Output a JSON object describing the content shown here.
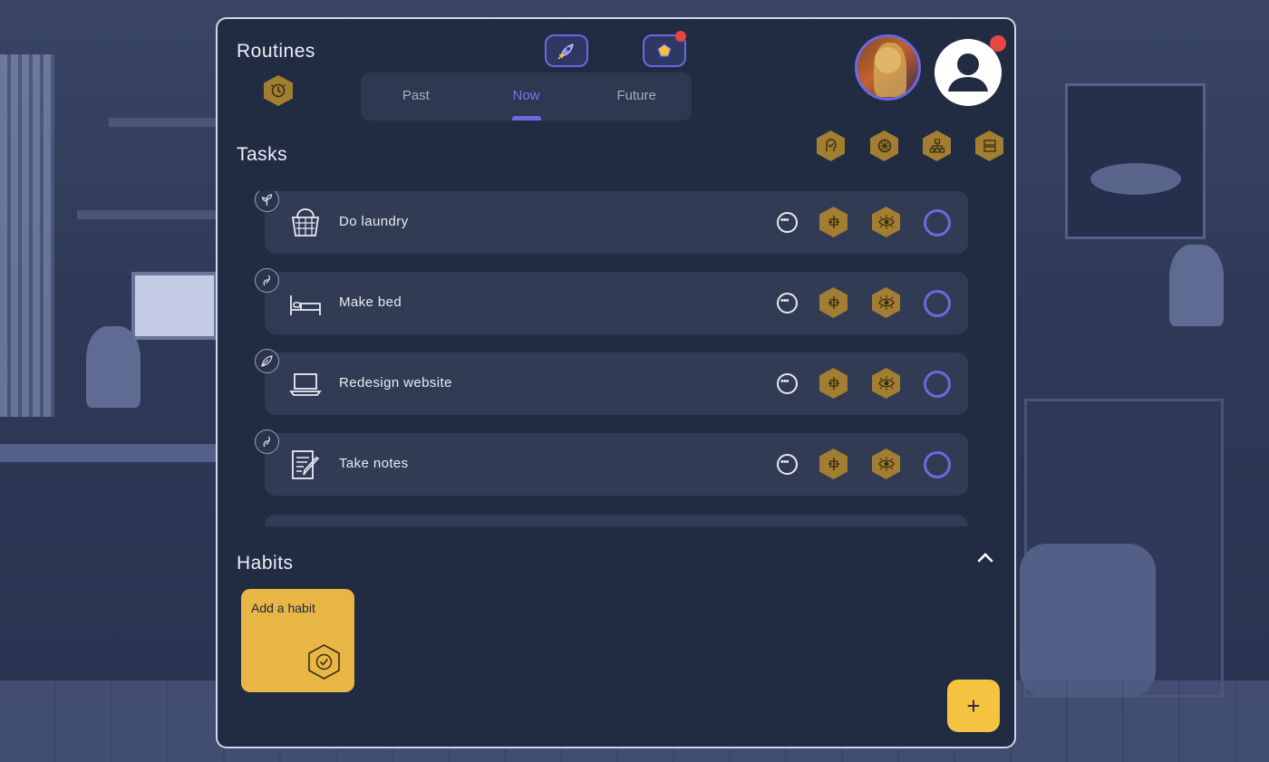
{
  "routines": {
    "title": "Routines"
  },
  "tabs": [
    {
      "label": "Past",
      "active": false
    },
    {
      "label": "Now",
      "active": true
    },
    {
      "label": "Future",
      "active": false
    }
  ],
  "tasks": {
    "title": "Tasks",
    "items": [
      {
        "label": "Do laundry",
        "icon": "laundry-basket-icon",
        "badge_icon": "sprout-icon"
      },
      {
        "label": "Make bed",
        "icon": "bed-icon",
        "badge_icon": "spiral-leaf-icon"
      },
      {
        "label": "Redesign website",
        "icon": "laptop-icon",
        "badge_icon": "leaf-icon"
      },
      {
        "label": "Take notes",
        "icon": "notepad-icon",
        "badge_icon": "spiral-leaf-icon"
      }
    ]
  },
  "habits": {
    "title": "Habits",
    "add_label": "Add a habit"
  },
  "fab": {
    "label": "+"
  },
  "colors": {
    "accent": "#6e67e0",
    "gold": "#a17e32",
    "habit_card": "#e7b645",
    "panel": "#212b42",
    "notification": "#e84545"
  }
}
